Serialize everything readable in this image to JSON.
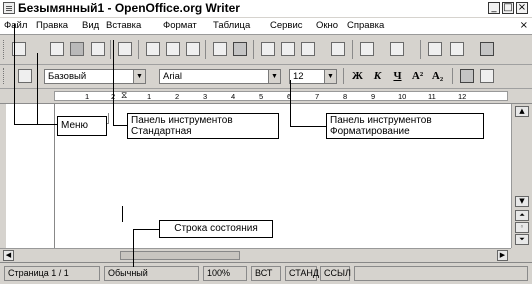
{
  "window": {
    "title": "Безымянный1 - OpenOffice.org Writer"
  },
  "window_buttons": {
    "minimize": "_",
    "maximize": "□",
    "close": "×"
  },
  "menu": {
    "items": [
      "Файл",
      "Правка",
      "Вид",
      "Вставка",
      "Формат",
      "Таблица",
      "Сервис",
      "Окно",
      "Справка"
    ],
    "close": "×"
  },
  "formatting": {
    "style": "Базовый",
    "font": "Arial",
    "size": "12",
    "bold": "Ж",
    "italic": "К",
    "underline": "Ч",
    "grow": "A²",
    "shrink": "A₂"
  },
  "ruler": {
    "marks": [
      "1",
      "2",
      "1",
      "2",
      "3",
      "4",
      "5",
      "6",
      "7",
      "8",
      "9",
      "10",
      "11",
      "12"
    ]
  },
  "callouts": {
    "menu": "Меню",
    "standard": "Панель инструментов Стандартная",
    "formatting": "Панель инструментов Форматирование",
    "statusbar": "Строка состояния"
  },
  "status": {
    "page": "Страница 1 / 1",
    "style": "Обычный",
    "zoom": "100%",
    "insert": "ВСТ",
    "selection": "СТАНД",
    "hyperlink": "ССЫЛ"
  }
}
